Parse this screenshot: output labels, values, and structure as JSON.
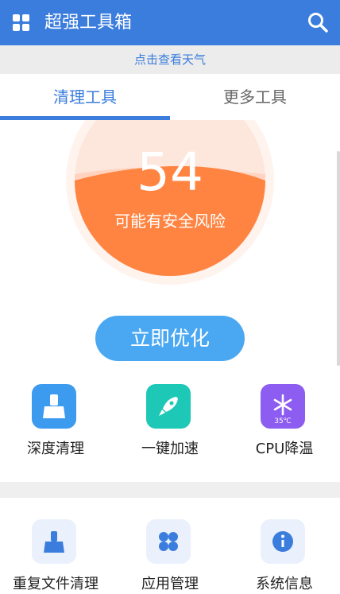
{
  "header": {
    "title": "超强工具箱",
    "menu_icon": "grid-icon",
    "search_icon": "search-icon"
  },
  "weather_link": "点击查看天气",
  "tabs": [
    {
      "label": "清理工具",
      "active": true
    },
    {
      "label": "更多工具",
      "active": false
    }
  ],
  "gauge": {
    "score": "54",
    "status": "可能有安全风险",
    "fill_level": 0.54,
    "color": "#ff8442"
  },
  "optimize_button": "立即优化",
  "quick_tools": [
    {
      "label": "深度清理",
      "icon": "broom-icon",
      "color": "#3d9bef"
    },
    {
      "label": "一键加速",
      "icon": "rocket-icon",
      "color": "#1ec8b6"
    },
    {
      "label": "CPU降温",
      "icon": "snowflake-icon",
      "color": "#8d5cf0",
      "badge": "35℃"
    }
  ],
  "more_tools": [
    {
      "label": "重复文件清理",
      "icon": "broom-icon"
    },
    {
      "label": "应用管理",
      "icon": "apps-icon"
    },
    {
      "label": "系统信息",
      "icon": "info-icon"
    }
  ],
  "colors": {
    "primary": "#3b7ddd",
    "button": "#4aa8f2"
  }
}
